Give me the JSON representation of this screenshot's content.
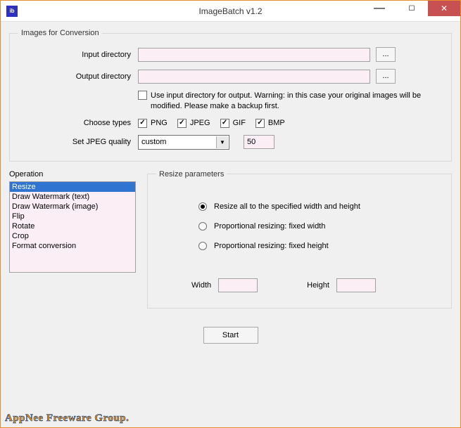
{
  "window": {
    "title": "ImageBatch v1.2",
    "icon_text": "ib"
  },
  "images_group": {
    "legend": "Images for Conversion",
    "input_dir_label": "Input directory",
    "input_dir_value": "",
    "input_browse": "...",
    "output_dir_label": "Output directory",
    "output_dir_value": "",
    "output_browse": "...",
    "use_input_checked": false,
    "use_input_text": "Use input directory for output. Warning: in this case your original images will be modified. Please make a backup first.",
    "choose_types_label": "Choose types",
    "types": [
      {
        "label": "PNG",
        "checked": true
      },
      {
        "label": "JPEG",
        "checked": true
      },
      {
        "label": "GIF",
        "checked": true
      },
      {
        "label": "BMP",
        "checked": true
      }
    ],
    "jpeg_quality_label": "Set JPEG quality",
    "jpeg_quality_mode": "custom",
    "jpeg_quality_value": "50"
  },
  "operation": {
    "legend": "Operation",
    "items": [
      "Resize",
      "Draw Watermark (text)",
      "Draw Watermark (image)",
      "Flip",
      "Rotate",
      "Crop",
      "Format conversion"
    ],
    "selected_index": 0
  },
  "resize_params": {
    "legend": "Resize parameters",
    "radios": [
      {
        "label": "Resize all to the specified width and height",
        "checked": true
      },
      {
        "label": "Proportional resizing: fixed width",
        "checked": false
      },
      {
        "label": "Proportional resizing: fixed height",
        "checked": false
      }
    ],
    "width_label": "Width",
    "width_value": "",
    "height_label": "Height",
    "height_value": ""
  },
  "start_label": "Start",
  "watermark_text": "AppNee Freeware Group."
}
